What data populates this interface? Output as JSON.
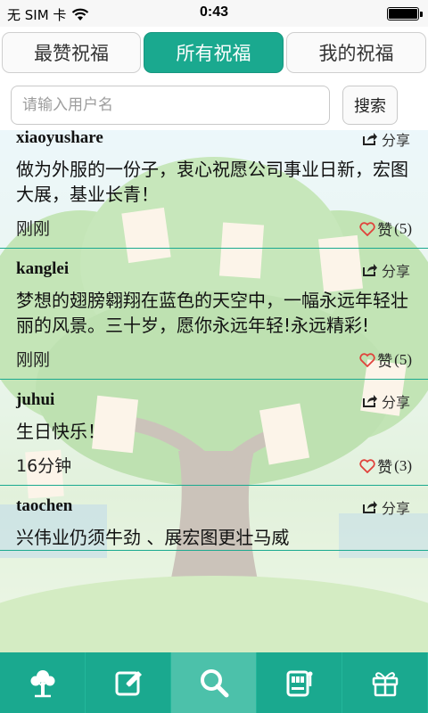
{
  "status_bar": {
    "carrier": "无 SIM 卡",
    "time": "0:43",
    "wifi_icon": "wifi-icon",
    "battery_level": 1.0
  },
  "tabs": [
    {
      "label": "最赞祝福",
      "active": false
    },
    {
      "label": "所有祝福",
      "active": true
    },
    {
      "label": "我的祝福",
      "active": false
    }
  ],
  "search": {
    "placeholder": "请输入用户名",
    "value": "",
    "button_label": "搜索"
  },
  "posts": [
    {
      "username": "xiaoyushare",
      "share_label": "分享",
      "content": "做为外服的一份子，衷心祝愿公司事业日新，宏图大展，基业长青！",
      "time": "刚刚",
      "like_label": "赞",
      "like_count": "(5)"
    },
    {
      "username": "kanglei",
      "share_label": "分享",
      "content": "梦想的翅膀翱翔在蓝色的天空中，一幅永远年轻壮丽的风景。三十岁，愿你永远年轻!永远精彩!",
      "time": "刚刚",
      "like_label": "赞",
      "like_count": "(5)"
    },
    {
      "username": "juhui",
      "share_label": "分享",
      "content": "生日快乐！",
      "time": "16分钟",
      "like_label": "赞",
      "like_count": "(3)"
    },
    {
      "username": "taochen",
      "share_label": "分享",
      "content": "兴伟业仍须牛劲 、展宏图更壮马威",
      "time": "",
      "like_label": "",
      "like_count": ""
    }
  ],
  "bottom_nav": [
    {
      "icon": "tree-icon",
      "active": false
    },
    {
      "icon": "edit-icon",
      "active": false
    },
    {
      "icon": "search-icon",
      "active": true
    },
    {
      "icon": "slot-machine-icon",
      "active": false
    },
    {
      "icon": "gift-icon",
      "active": false
    }
  ],
  "colors": {
    "accent": "#1aa98f",
    "accent_light": "#4cc1aa",
    "heart": "#e0433c"
  }
}
